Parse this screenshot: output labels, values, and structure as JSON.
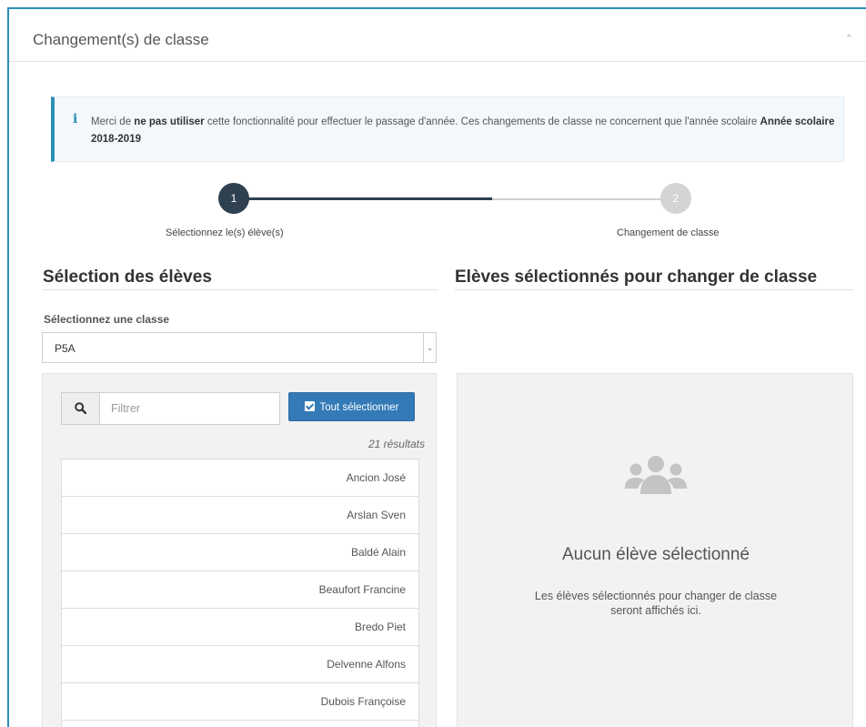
{
  "panel": {
    "title": "Changement(s) de classe",
    "collapse_icon": "chevron-up-icon"
  },
  "alert": {
    "icon": "info-icon",
    "text_before": "Merci de ",
    "text_bold": "ne pas utiliser",
    "text_middle": " cette fonctionnalité pour effectuer le passage d'année. Ces changements de classe ne concernent que l'année scolaire ",
    "text_year": "Année scolaire 2018-2019"
  },
  "stepper": {
    "steps": [
      {
        "number": "1",
        "label": "Sélectionnez le(s) élève(s)",
        "state": "active"
      },
      {
        "number": "2",
        "label": "Changement de classe",
        "state": "inactive"
      }
    ],
    "active_color": "#2f4050",
    "inactive_color": "#d4d4d4"
  },
  "selection": {
    "title": "Sélection des élèves",
    "class_label": "Sélectionnez une classe",
    "class_value": "P5A",
    "filter_placeholder": "Filtrer",
    "select_all_label": "Tout sélectionner",
    "results": "21 résultats",
    "students": [
      "Ancion José",
      "Arslan Sven",
      "Baldé Alain",
      "Beaufort Francine",
      "Bredo Piet",
      "Delvenne Alfons",
      "Dubois Françoise"
    ]
  },
  "selected": {
    "title": "Elèves sélectionnés pour changer de classe",
    "empty_icon": "users-icon",
    "empty_title": "Aucun élève sélectionné",
    "empty_text": "Les élèves sélectionnés pour changer de classe seront affichés ici."
  },
  "colors": {
    "accent": "#2c8fb5",
    "primary_button": "#337ab7"
  }
}
